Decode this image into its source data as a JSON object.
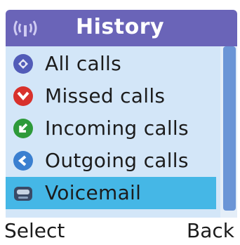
{
  "header": {
    "title": "History",
    "signal_icon": "signal-antenna-icon"
  },
  "menu": {
    "items": [
      {
        "label": "All calls",
        "icon": "all-calls-icon",
        "color": "#525cb8",
        "selected": false
      },
      {
        "label": "Missed calls",
        "icon": "missed-calls-icon",
        "color": "#d8312c",
        "selected": false
      },
      {
        "label": "Incoming calls",
        "icon": "incoming-calls-icon",
        "color": "#2e9a3a",
        "selected": false
      },
      {
        "label": "Outgoing calls",
        "icon": "outgoing-calls-icon",
        "color": "#3a7fd0",
        "selected": false
      },
      {
        "label": "Voicemail",
        "icon": "voicemail-icon",
        "color": "#3a4a66",
        "selected": true
      }
    ]
  },
  "softkeys": {
    "left": "Select",
    "right": "Back"
  },
  "colors": {
    "header_bg": "#6a64b8",
    "list_bg": "#d3e6f8",
    "selection": "#45b7e6",
    "scroll_thumb": "#6b95d6"
  }
}
